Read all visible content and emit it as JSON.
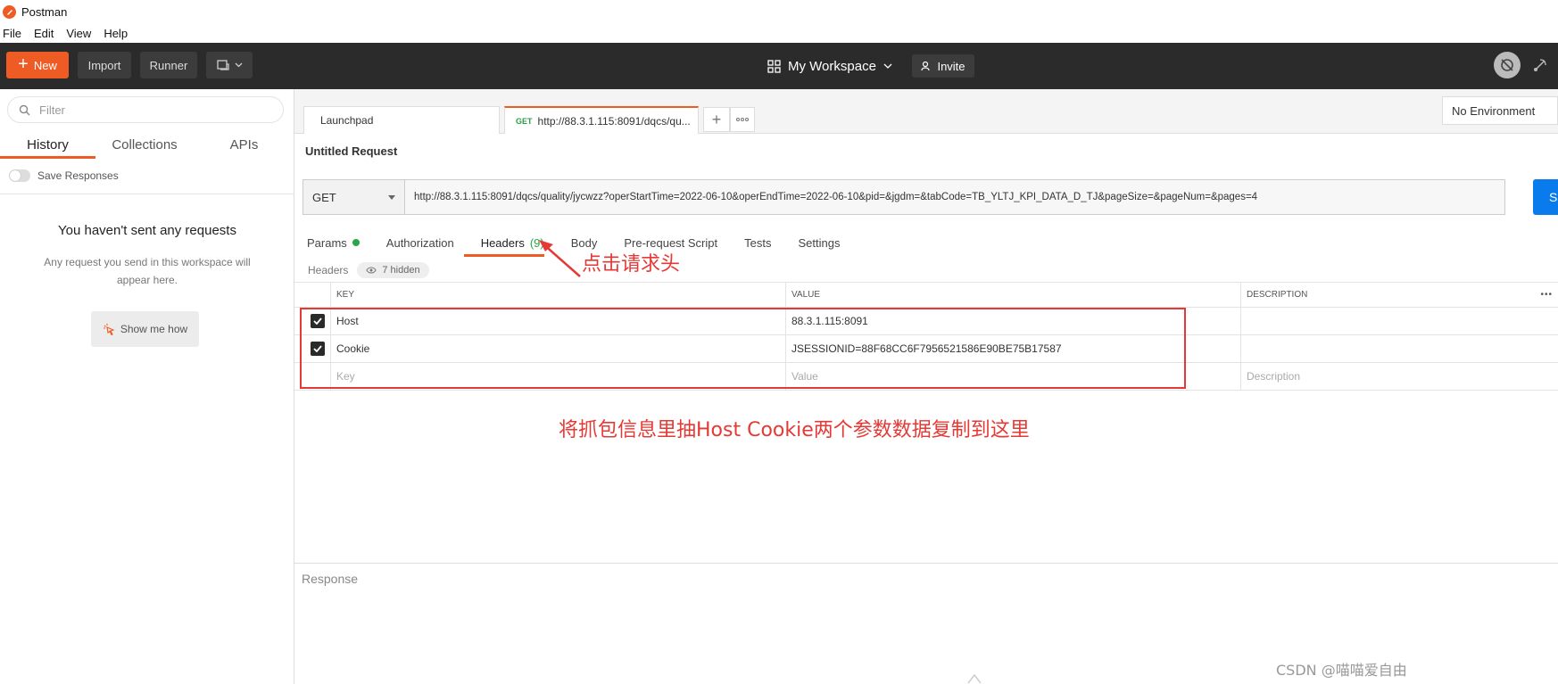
{
  "app": {
    "title": "Postman"
  },
  "menu": [
    "File",
    "Edit",
    "View",
    "Help"
  ],
  "header": {
    "new_label": "New",
    "import_label": "Import",
    "runner_label": "Runner",
    "workspace_label": "My Workspace",
    "invite_label": "Invite"
  },
  "sidebar": {
    "filter_placeholder": "Filter",
    "tabs": [
      "History",
      "Collections",
      "APIs"
    ],
    "save_responses_label": "Save Responses",
    "empty_title": "You haven't sent any requests",
    "empty_desc": "Any request you send in this workspace will appear here.",
    "show_me_how_label": "Show me how"
  },
  "tabs": {
    "launchpad": "Launchpad",
    "active_method": "GET",
    "active_url": "http://88.3.1.115:8091/dqcs/qu..."
  },
  "environment": "No Environment",
  "request": {
    "title": "Untitled Request",
    "method": "GET",
    "url": "http://88.3.1.115:8091/dqcs/quality/jycwzz?operStartTime=2022-06-10&operEndTime=2022-06-10&pid=&jgdm=&tabCode=TB_YLTJ_KPI_DATA_D_TJ&pageSize=&pageNum=&pages=4",
    "send_label": "Send",
    "tabs": {
      "params": "Params",
      "authorization": "Authorization",
      "headers": "Headers",
      "headers_count": "(9)",
      "body": "Body",
      "prerequest": "Pre-request Script",
      "tests": "Tests",
      "settings": "Settings"
    }
  },
  "headers_section": {
    "label": "Headers",
    "hidden_label": "7 hidden",
    "columns": {
      "key": "KEY",
      "value": "VALUE",
      "description": "DESCRIPTION"
    },
    "rows": [
      {
        "key": "Host",
        "value": "88.3.1.115:8091"
      },
      {
        "key": "Cookie",
        "value": "JSESSIONID=88F68CC6F7956521586E90BE75B17587"
      }
    ],
    "placeholders": {
      "key": "Key",
      "value": "Value",
      "description": "Description"
    }
  },
  "annotations": {
    "click_headers": "点击请求头",
    "copy_note": "将抓包信息里抽Host   Cookie两个参数数据复制到这里",
    "color": "#e53935"
  },
  "response": {
    "label": "Response"
  },
  "watermark": "CSDN @喵喵爱自由",
  "colors": {
    "accent": "#ef5b25",
    "send": "#097bed",
    "header_bg": "#2b2b2b"
  }
}
